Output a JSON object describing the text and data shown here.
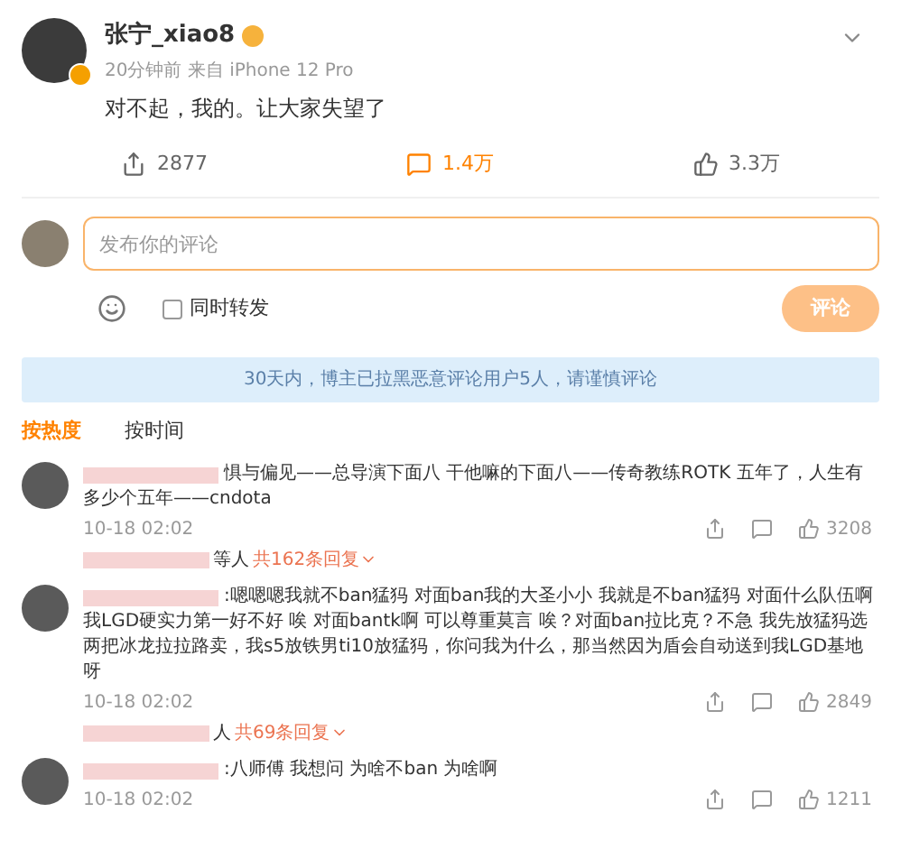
{
  "post": {
    "author": "张宁_xiao8",
    "meta": "20分钟前 来自 iPhone 12 Pro",
    "text": "对不起，我的。让大家失望了",
    "reposts": "2877",
    "comments": "1.4万",
    "likes": "3.3万"
  },
  "composer": {
    "placeholder": "发布你的评论",
    "repost_label": "同时转发",
    "repost_checked": false,
    "submit": "评论"
  },
  "notice": "30天内，博主已拉黑恶意评论用户5人，请谨慎评论",
  "sort_tabs": [
    {
      "label": "按热度",
      "selected": true
    },
    {
      "label": "按时间",
      "selected": false
    }
  ],
  "comments": [
    {
      "text": "惧与偏见——总导演下面八 干他嘛的下面八——传奇教练ROTK 五年了，人生有多少个五年——cndota",
      "time": "10-18 02:02",
      "likes": "3208",
      "reply_users": "等人",
      "reply_count": "共162条回复"
    },
    {
      "text": ":嗯嗯嗯我就不ban猛犸 对面ban我的大圣小小 我就是不ban猛犸 对面什么队伍啊我LGD硬实力第一好不好 唉 对面bantk啊 可以尊重莫言 唉？对面ban拉比克？不急 我先放猛犸选两把冰龙拉拉路卖，我s5放铁男ti10放猛犸，你问我为什么，那当然因为盾会自动送到我LGD基地呀",
      "time": "10-18 02:02",
      "likes": "2849",
      "reply_users": "人",
      "reply_count": "共69条回复"
    },
    {
      "text": ":八师傅 我想问 为啥不ban 为啥啊",
      "time": "10-18 02:02",
      "likes": "1211"
    }
  ]
}
